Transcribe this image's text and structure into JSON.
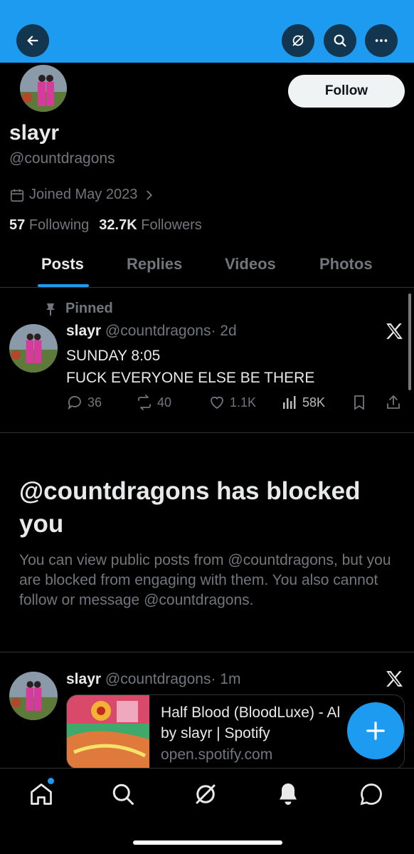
{
  "header": {
    "back_icon": "arrow-left-icon",
    "grok_icon": "grok-icon",
    "search_icon": "search-icon",
    "more_icon": "more-horizontal-icon",
    "banner_color": "#1d9bf0"
  },
  "profile": {
    "display_name": "slayr",
    "handle": "@countdragons",
    "follow_label": "Follow",
    "joined": "Joined May 2023",
    "following_count": "57",
    "following_label": "Following",
    "followers_count": "32.7K",
    "followers_label": "Followers"
  },
  "tabs": [
    {
      "label": "Posts",
      "active": true
    },
    {
      "label": "Replies",
      "active": false
    },
    {
      "label": "Videos",
      "active": false
    },
    {
      "label": "Photos",
      "active": false
    }
  ],
  "pinned_post": {
    "pinned_label": "Pinned",
    "author": "slayr",
    "handle": "@countdragons",
    "time": "· 2d",
    "line1": "SUNDAY 8:05",
    "line2": "FUCK EVERYONE ELSE BE THERE",
    "replies": "36",
    "reposts": "40",
    "likes": "1.1K",
    "views": "58K"
  },
  "blocked": {
    "title": "@countdragons has blocked you",
    "description": "You can view public posts from @countdragons, but you are blocked from engaging with them. You also cannot follow or message @countdragons."
  },
  "post2": {
    "author": "slayr",
    "handle": "@countdragons",
    "time": "· 1m",
    "card_title_line1": "Half Blood (BloodLuxe) - Al",
    "card_title_line2": "by slayr | Spotify",
    "card_domain": "open.spotify.com"
  },
  "colors": {
    "accent": "#1d9bf0",
    "text_primary": "#e7e9ea",
    "text_secondary": "#71767b",
    "border": "#2f3336"
  },
  "bottom_nav": [
    "home-icon",
    "search-icon",
    "grok-icon",
    "notifications-icon",
    "messages-icon"
  ]
}
